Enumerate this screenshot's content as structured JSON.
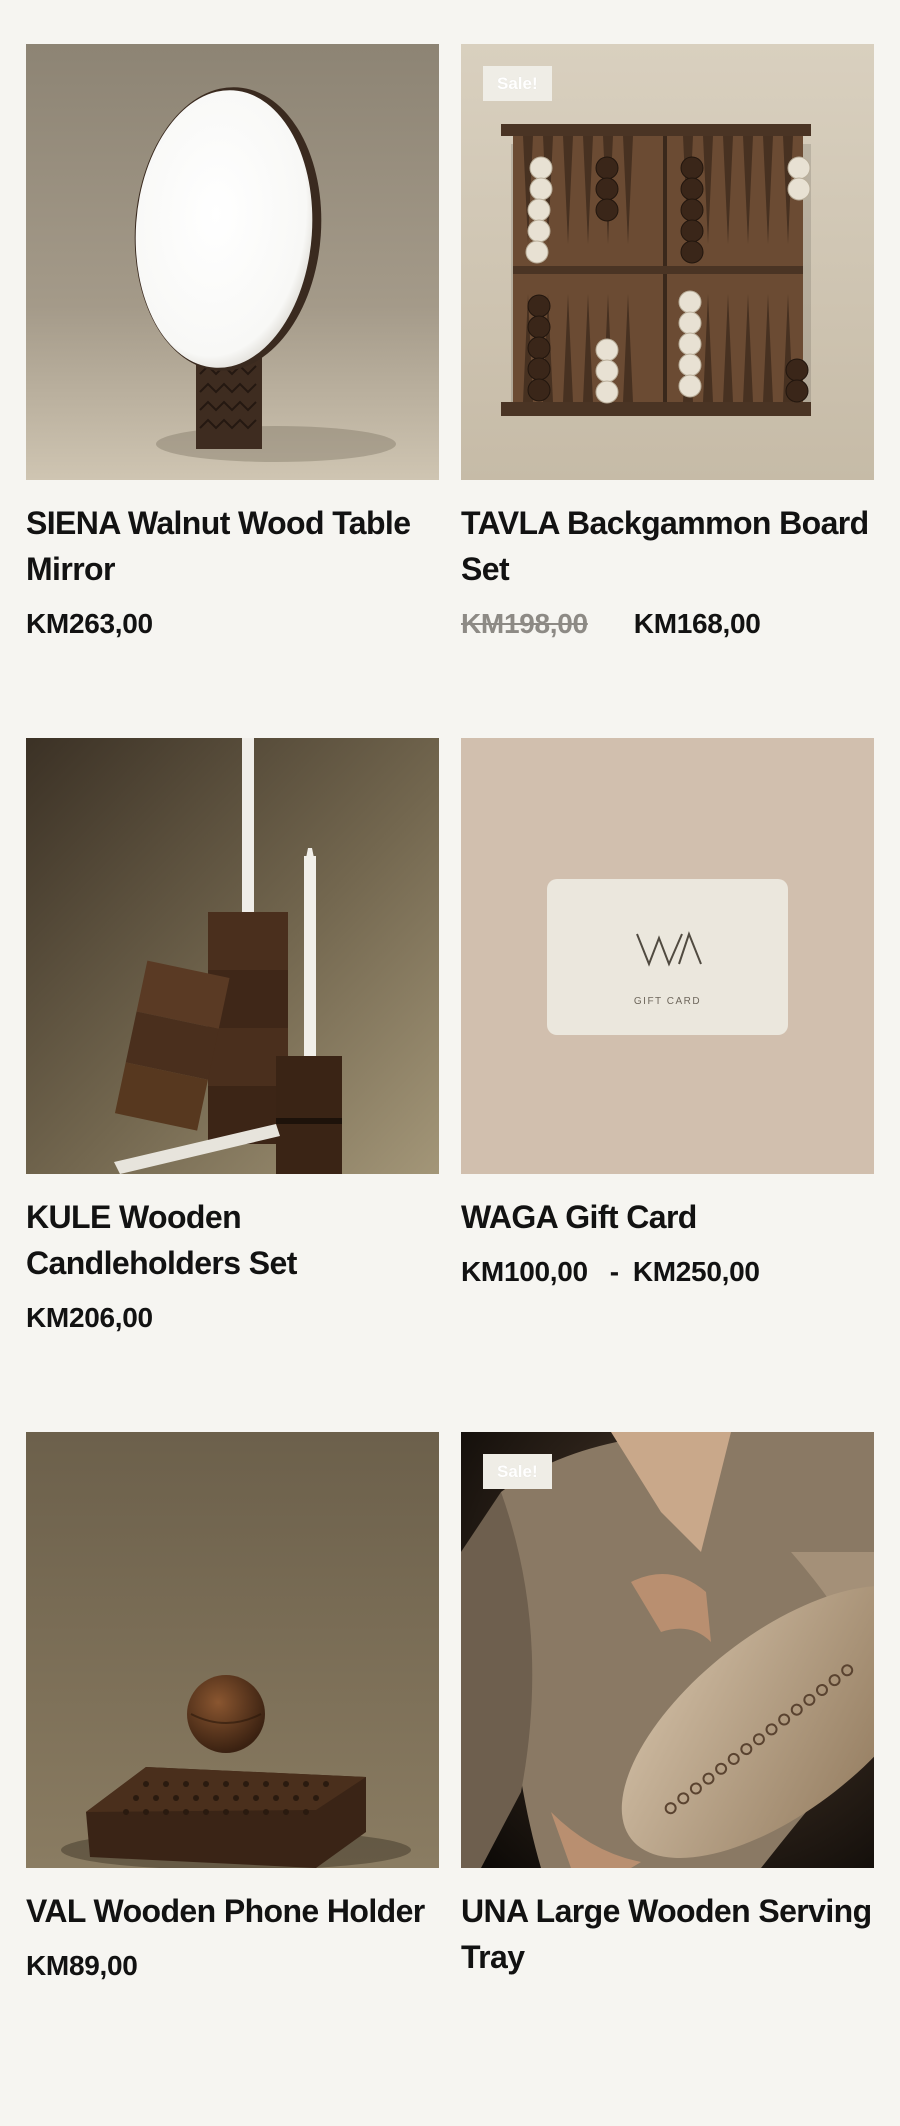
{
  "products": [
    {
      "title": "SIENA Walnut Wood Table Mirror",
      "price": "KM263,00",
      "image_icon": "table-mirror-image"
    },
    {
      "badge": "Sale!",
      "title": "TAVLA Backgammon Board Set",
      "old_price": "KM198,00",
      "price": "KM168,00",
      "image_icon": "backgammon-board-image"
    },
    {
      "title": "KULE Wooden Candleholders Set",
      "price": "KM206,00",
      "image_icon": "candleholders-image"
    },
    {
      "title": "WAGA Gift Card",
      "price_min": "KM100,00",
      "price_sep": "-",
      "price_max": "KM250,00",
      "card_logo": "WA",
      "card_label": "GIFT CARD",
      "image_icon": "gift-card-image"
    },
    {
      "title": "VAL Wooden Phone Holder",
      "price": "KM89,00",
      "image_icon": "phone-holder-image"
    },
    {
      "badge": "Sale!",
      "title": "UNA Large Wooden Serving Tray",
      "image_icon": "serving-tray-image"
    }
  ],
  "colors": {
    "background": "#f6f5f1",
    "text": "#121212",
    "old_price": "#8d8a85",
    "badge": "#efede6"
  }
}
